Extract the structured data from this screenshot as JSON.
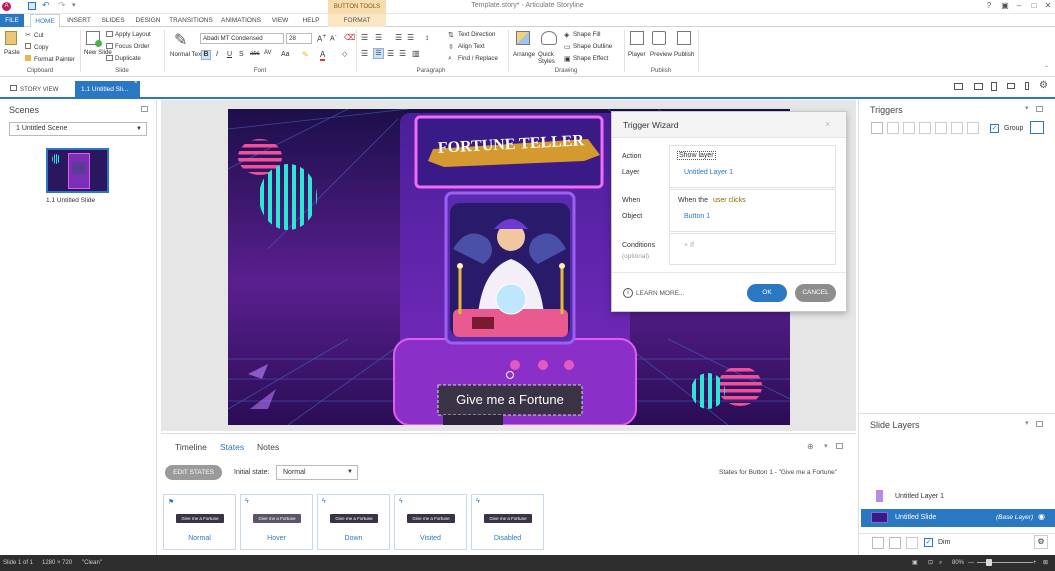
{
  "app": {
    "title": "Template.story* - Articulate Storyline",
    "icon_letter": "A"
  },
  "ribbon_tabs": [
    "FILE",
    "HOME",
    "INSERT",
    "SLIDES",
    "DESIGN",
    "TRANSITIONS",
    "ANIMATIONS",
    "VIEW",
    "HELP",
    "FORMAT"
  ],
  "context_tab": "BUTTON TOOLS",
  "clipboard": {
    "paste": "Paste",
    "cut": "Cut",
    "copy": "Copy",
    "format_painter": "Format Painter",
    "group": "Clipboard"
  },
  "slide_group": {
    "new_slide": "New Slide",
    "apply_layout": "Apply Layout",
    "focus_order": "Focus Order",
    "duplicate": "Duplicate",
    "group": "Slide"
  },
  "font_group": {
    "normal_text": "Normal Text",
    "font_name": "Abadi MT Condensed",
    "font_size": "28",
    "group": "Font"
  },
  "paragraph": {
    "text_direction": "Text Direction",
    "align_text": "Align Text",
    "find_replace": "Find / Replace",
    "group": "Paragraph"
  },
  "drawing": {
    "arrange": "Arrange",
    "quick_styles": "Quick Styles",
    "shape_fill": "Shape Fill",
    "shape_outline": "Shape Outline",
    "shape_effect": "Shape Effect",
    "group": "Drawing"
  },
  "publish": {
    "player": "Player",
    "preview": "Preview",
    "publish": "Publish",
    "group": "Publish"
  },
  "view_tabs": {
    "story_view": "STORY VIEW",
    "slide_tab": "1.1 Untitled Sli..."
  },
  "scenes": {
    "title": "Scenes",
    "selected": "1 Untitled Scene",
    "slide_label": "1.1 Untitled Slide"
  },
  "slide": {
    "banner": "FORTUNE TELLER",
    "button_text": "Give me a Fortune"
  },
  "wizard": {
    "title": "Trigger Wizard",
    "action_label": "Action",
    "action_value": "Show layer",
    "layer_label": "Layer",
    "layer_value": "Untitled Layer 1",
    "when_label": "When",
    "when_prefix": "When the",
    "when_value": "user clicks",
    "object_label": "Object",
    "object_value": "Button 1",
    "conditions_label": "Conditions",
    "conditions_sub": "(optional)",
    "if_text": "+ If",
    "learn_more": "LEARN MORE...",
    "ok": "OK",
    "cancel": "CANCEL"
  },
  "triggers": {
    "title": "Triggers",
    "group_label": "Group",
    "group_checked": true
  },
  "slide_layers": {
    "title": "Slide Layers",
    "layers": [
      {
        "name": "Untitled Layer 1"
      },
      {
        "name": "Untitled Slide",
        "tag": "(Base Layer)"
      }
    ],
    "dim_label": "Dim",
    "dim_checked": true
  },
  "bottom": {
    "tabs": [
      "Timeline",
      "States",
      "Notes"
    ],
    "active_tab": "States",
    "edit_states": "EDIT STATES",
    "initial_state_label": "Initial state:",
    "initial_state_value": "Normal",
    "states_for": "States for Button 1 - \"Give me a Fortune\"",
    "thumb_text": "Give me a Fortune",
    "states": [
      "Normal",
      "Hover",
      "Down",
      "Visited",
      "Disabled"
    ]
  },
  "status": {
    "slide": "Slide 1 of 1",
    "size": "1280 × 720",
    "clean": "\"Clean\"",
    "zoom": "80%"
  }
}
